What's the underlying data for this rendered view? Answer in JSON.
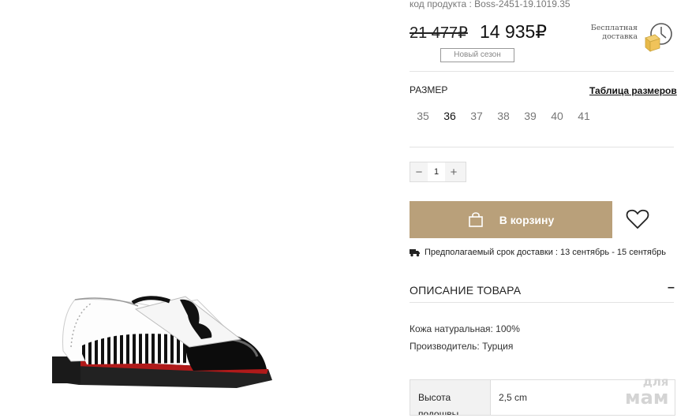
{
  "product": {
    "sku_label": "код продукта :",
    "sku_value": "Boss-2451-19.1019.35",
    "old_price": "21 477₽",
    "new_price": "14 935₽",
    "badge": "Новый сезон"
  },
  "free_delivery": {
    "line1": "Бесплатная",
    "line2": "доставка",
    "icon": "delivery-clock-box-icon"
  },
  "sizes": {
    "title": "РАЗМЕР",
    "table_link": "Таблица размеров",
    "options": [
      "35",
      "36",
      "37",
      "38",
      "39",
      "40",
      "41"
    ],
    "selected": "36"
  },
  "quantity": {
    "minus": "−",
    "value": "1",
    "plus": "+"
  },
  "cart": {
    "label": "В корзину"
  },
  "delivery": {
    "text": "Предполагаемый срок доставки : 13 сентябрь - 15 сентябрь"
  },
  "description": {
    "title": "ОПИСАНИЕ ТОВАРА",
    "toggle": "–",
    "lines": [
      "Кожа натуральная: 100%",
      "Производитель: Турция"
    ],
    "spec_key": "Высота подошвы",
    "spec_value": "2,5 cm"
  },
  "watermark": {
    "line1": "для",
    "line2": "мам"
  },
  "colors": {
    "accent": "#b9a07a",
    "text": "#222222",
    "muted": "#777777"
  }
}
